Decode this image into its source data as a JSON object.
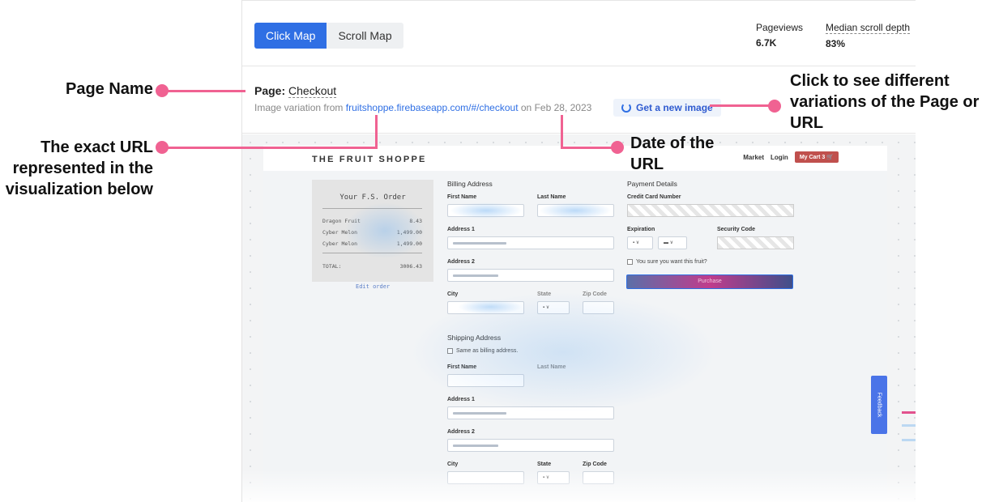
{
  "annotations": {
    "page_name": "Page Name",
    "exact_url": [
      "The exact URL",
      "represented in the",
      "visualization below"
    ],
    "variations": [
      "Click to see different",
      "variations of the Page or",
      "URL"
    ],
    "date": [
      "Date of the",
      "URL"
    ],
    "accent_color": "#f06292"
  },
  "toolbar": {
    "click_map": "Click Map",
    "scroll_map": "Scroll Map",
    "active_color": "#2f6fe4"
  },
  "stats": {
    "pageviews_label": "Pageviews",
    "pageviews_value": "6.7K",
    "scroll_label": "Median scroll depth",
    "scroll_value": "83%"
  },
  "page": {
    "label": "Page:",
    "name": "Checkout",
    "variation_prefix": "Image variation from",
    "url": "fruitshoppe.firebaseapp.com/#/checkout",
    "date_prefix": "on",
    "date": "Feb 28, 2023",
    "new_image": "Get a new image",
    "new_image_icon": "refresh-icon"
  },
  "site": {
    "logo": "THE FRUIT SHOPPE",
    "nav_market": "Market",
    "nav_login": "Login",
    "cart": "My Cart  3",
    "cart_icon": "cart-icon",
    "receipt": {
      "title": "Your F.S. Order",
      "items": [
        {
          "name": "Dragon Fruit",
          "price": "8.43"
        },
        {
          "name": "Cyber Melon",
          "price": "1,499.00"
        },
        {
          "name": "Cyber Melon",
          "price": "1,499.00"
        }
      ],
      "total_label": "TOTAL:",
      "total": "3006.43",
      "edit": "Edit order"
    },
    "billing": {
      "title": "Billing Address",
      "first": "First Name",
      "last": "Last Name",
      "addr1": "Address 1",
      "addr2": "Address 2",
      "city": "City",
      "state": "State",
      "zip": "Zip Code"
    },
    "payment": {
      "title": "Payment Details",
      "card": "Credit Card Number",
      "expiration": "Expiration",
      "security": "Security Code",
      "confirm": "You sure you want this fruit?",
      "purchase": "Purchase"
    },
    "shipping": {
      "title": "Shipping Address",
      "same": "Same as billing address.",
      "first": "First Name",
      "last": "Last Name",
      "addr1": "Address 1",
      "addr2": "Address 2",
      "city": "City",
      "state": "State",
      "zip": "Zip Code"
    },
    "feedback": "Feedback"
  }
}
